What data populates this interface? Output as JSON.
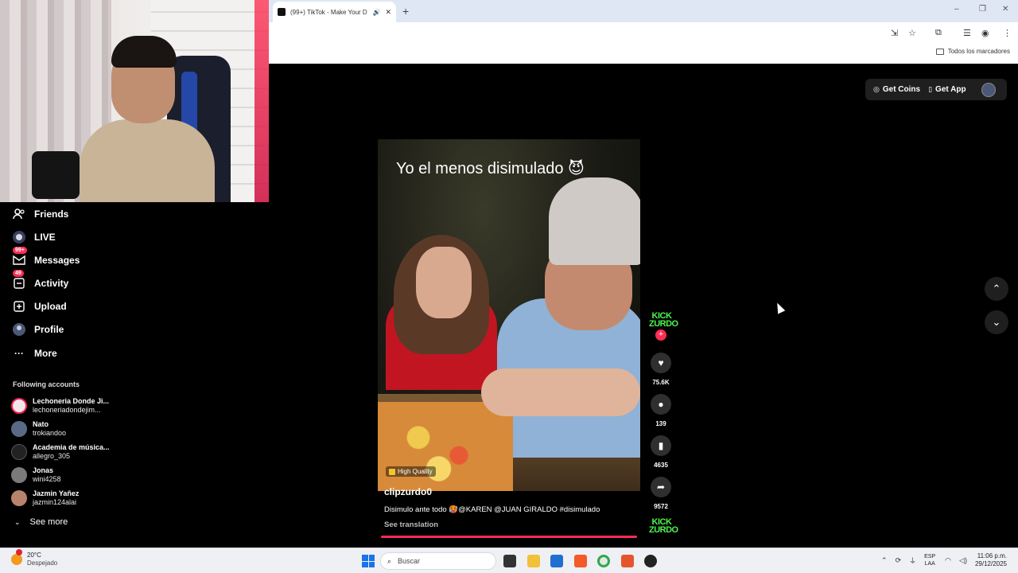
{
  "browser": {
    "tab_title": "(99+) TikTok - Make Your D",
    "new_tab_symbol": "+",
    "bookmarks_label": "Todos los marcadores"
  },
  "topbar": {
    "get_coins": "Get Coins",
    "get_app": "Get App"
  },
  "sidebar": {
    "items": [
      {
        "label": "Friends",
        "icon": "friends-icon"
      },
      {
        "label": "LIVE",
        "icon": "live-icon"
      },
      {
        "label": "Messages",
        "icon": "messages-icon",
        "badge": "99+"
      },
      {
        "label": "Activity",
        "icon": "activity-icon",
        "badge": "49"
      },
      {
        "label": "Upload",
        "icon": "upload-icon"
      },
      {
        "label": "Profile",
        "icon": "profile-icon"
      },
      {
        "label": "More",
        "icon": "more-icon"
      }
    ],
    "following_title": "Following accounts",
    "accounts": [
      {
        "name": "Lechoneria Donde Ji...",
        "username": "lechoneriadondejim..."
      },
      {
        "name": "Nato",
        "username": "trokiandoo"
      },
      {
        "name": "Academia de música...",
        "username": "allegro_305"
      },
      {
        "name": "Jonas",
        "username": "wini4258"
      },
      {
        "name": "Jazmin Yañez",
        "username": "jazmin124alai"
      }
    ],
    "see_more": "See more"
  },
  "video": {
    "overlay_text": "Yo el menos disimulado 😈",
    "quality_label": "High Quality",
    "author": "clipzurdo0",
    "description": "Disimulo ante todo 🥵@KAREN @JUAN GIRALDO #disimulado",
    "see_translation": "See translation",
    "progress": 1.0
  },
  "actions": {
    "author_avatar_text": "KICK ZURDO",
    "likes": "75.6K",
    "comments": "139",
    "saves": "4635",
    "shares": "9572"
  },
  "taskbar": {
    "temperature": "20°C",
    "weather": "Despejado",
    "search_placeholder": "Buscar",
    "lang_line1": "ESP",
    "lang_line2": "LAA",
    "time": "11:06 p.m.",
    "date": "29/12/2025"
  },
  "colors": {
    "accent": "#fe2c55",
    "background": "#000000",
    "kick_green": "#4cf54c"
  }
}
